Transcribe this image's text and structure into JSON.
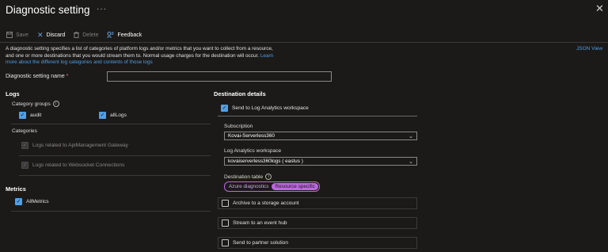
{
  "header": {
    "title": "Diagnostic setting",
    "more_glyph": "···",
    "close_glyph": "✕"
  },
  "toolbar": {
    "save": {
      "label": "Save",
      "icon": "save-icon"
    },
    "discard": {
      "label": "Discard",
      "icon": "close-icon"
    },
    "delete": {
      "label": "Delete",
      "icon": "trash-icon"
    },
    "feedback": {
      "label": "Feedback",
      "icon": "feedback-icon"
    }
  },
  "description": {
    "line1": "A diagnostic setting specifies a list of categories of platform logs and/or metrics that you want to collect from a resource,",
    "line2": "and one or more destinations that you would stream them to. Normal usage charges for the destination will occur.",
    "link1": "Learn",
    "link2": "more about the different log categories and contents of those logs"
  },
  "json_view": "JSON View",
  "name_field": {
    "label": "Diagnostic setting name",
    "required_mark": "*",
    "value": ""
  },
  "logs": {
    "heading": "Logs",
    "category_groups_label": "Category groups",
    "category_groups": [
      {
        "label": "audit",
        "checked": true
      },
      {
        "label": "allLogs",
        "checked": true
      }
    ],
    "categories_label": "Categories",
    "categories": [
      {
        "label": "Logs related to ApiManagement Gateway",
        "checked": true,
        "disabled": true
      },
      {
        "label": "Logs related to Websocket Connections",
        "checked": true,
        "disabled": true
      }
    ]
  },
  "metrics": {
    "heading": "Metrics",
    "items": [
      {
        "label": "AllMetrics",
        "checked": true
      }
    ]
  },
  "destination": {
    "heading": "Destination details",
    "log_analytics": {
      "label": "Send to Log Analytics workspace",
      "checked": true
    },
    "subscription_label": "Subscription",
    "subscription_value": "Kovai-Serverless360",
    "workspace_label": "Log Analytics workspace",
    "workspace_value": "kovaiserverless360logs ( eastus )",
    "table_label": "Destination table",
    "table_options": [
      {
        "label": "Azure diagnostics",
        "selected": false
      },
      {
        "label": "Resource specific",
        "selected": true
      }
    ],
    "storage": {
      "label": "Archive to a storage account",
      "checked": false
    },
    "event_hub": {
      "label": "Stream to an event hub",
      "checked": false
    },
    "partner": {
      "label": "Send to partner solution",
      "checked": false
    }
  },
  "colors": {
    "background": "#1b1a19",
    "accent": "#4fa0e8",
    "link": "#4f9ee3",
    "pill": "#b86ad9"
  }
}
